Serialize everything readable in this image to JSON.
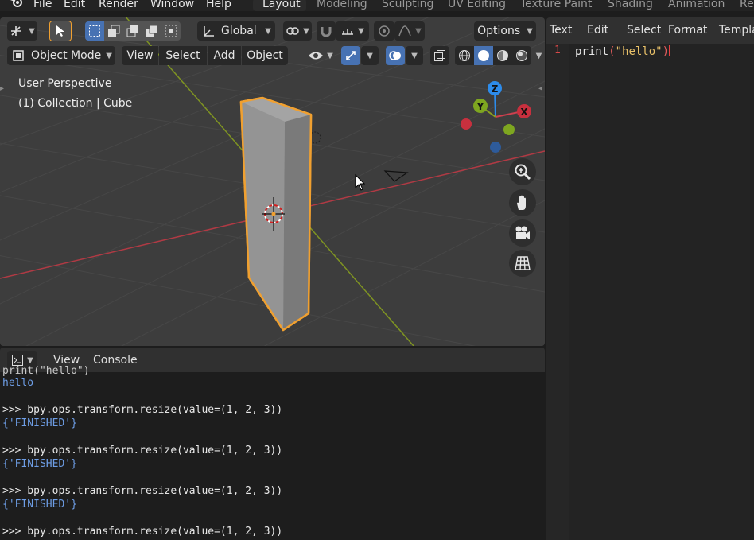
{
  "menubar": {
    "items": [
      "File",
      "Edit",
      "Render",
      "Window",
      "Help"
    ],
    "workspaces": [
      "Layout",
      "Modeling",
      "Sculpting",
      "UV Editing",
      "Texture Paint",
      "Shading",
      "Animation",
      "Re"
    ],
    "active_workspace": "Layout"
  },
  "viewport": {
    "header": {
      "transform_orientation": "Global",
      "options_label": "Options",
      "mode": "Object Mode",
      "menus": [
        "View",
        "Select",
        "Add",
        "Object"
      ]
    },
    "overlay": {
      "perspective": "User Perspective",
      "collection": "(1) Collection | Cube"
    },
    "gizmo": {
      "z": "Z",
      "y": "Y",
      "x": "X"
    },
    "colors": {
      "background": "#3d3d3d",
      "selection": "#f0a030",
      "x_axis": "#b03a44",
      "y_axis": "#8aa020",
      "active_button": "#4772b3"
    }
  },
  "console": {
    "menus": [
      "View",
      "Console"
    ],
    "lines": [
      {
        "kind": "out",
        "text": "print(\"hello\")"
      },
      {
        "kind": "out",
        "text": "hello"
      },
      {
        "kind": "cmd",
        "text": ">>> bpy.ops.transform.resize(value=(1, 2, 3))"
      },
      {
        "kind": "out",
        "text": "{'FINISHED'}"
      },
      {
        "kind": "cmd",
        "text": ">>> bpy.ops.transform.resize(value=(1, 2, 3))"
      },
      {
        "kind": "out",
        "text": "{'FINISHED'}"
      },
      {
        "kind": "cmd",
        "text": ">>> bpy.ops.transform.resize(value=(1, 2, 3))"
      },
      {
        "kind": "out",
        "text": "{'FINISHED'}"
      },
      {
        "kind": "cmd",
        "text": ">>> bpy.ops.transform.resize(value=(1, 2, 3))"
      }
    ]
  },
  "text_editor": {
    "menus": [
      "Text",
      "Edit",
      "Select",
      "Format",
      "Templa"
    ],
    "line_number": "1",
    "code": {
      "fn": "print",
      "open": "(",
      "str": "\"hello\"",
      "close": ")"
    }
  }
}
